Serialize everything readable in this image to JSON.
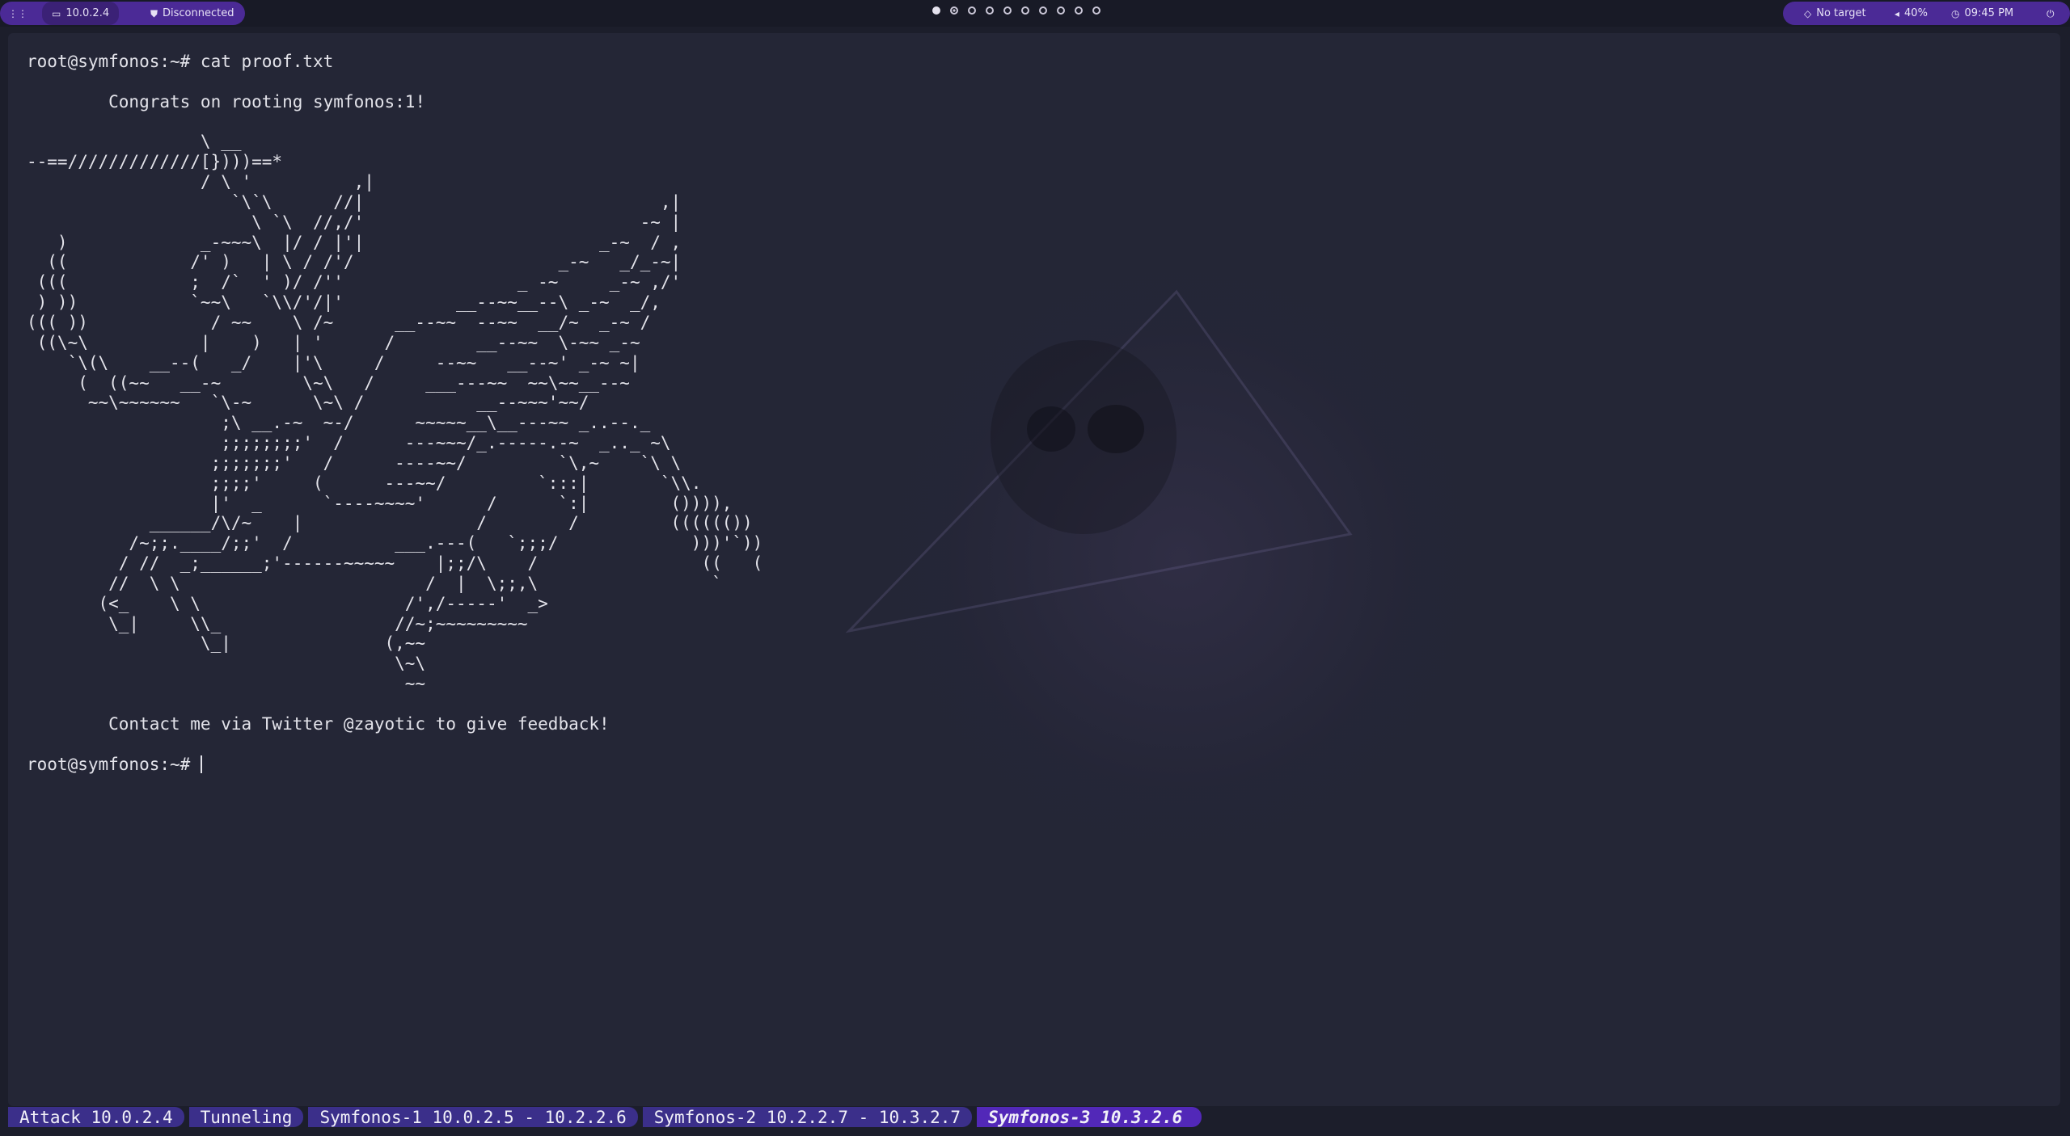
{
  "topbar": {
    "apps_icon": "grid-icon",
    "ip": "10.0.2.4",
    "vpn_status": "Disconnected",
    "workspaces": {
      "count": 10,
      "active_index": 1,
      "occupied_indices": [
        0
      ]
    },
    "target": "No target",
    "volume": "40%",
    "clock": "09:45 PM",
    "power_icon": "power-icon"
  },
  "terminal": {
    "lines": [
      "root@symfonos:~# cat proof.txt",
      "",
      "        Congrats on rooting symfonos:1!",
      "",
      "                 \\ __",
      "--==/////////////[})))==*",
      "                 / \\ '          ,|",
      "                    `\\`\\      //|                             ,|",
      "                      \\ `\\  //,/'                           -~ |",
      "   )             _-~~~\\  |/ / |'|                       _-~  / ,",
      "  ((            /' )   | \\ / /'/                    _-~   _/_-~|",
      " (((            ;  /`  ' )/ /''                 _ -~     _-~ ,/'",
      " ) ))           `~~\\   `\\\\/'/|'           __--~~__--\\ _-~  _/,",
      "((( ))            / ~~    \\ /~      __--~~  --~~  __/~  _-~ /",
      " ((\\~\\           |    )   | '      /        __--~~  \\-~~ _-~",
      "    `\\(\\    __--(   _/    |'\\     /     --~~   __--~' _-~ ~|",
      "     (  ((~~   __-~        \\~\\   /     ___---~~  ~~\\~~__--~",
      "      ~~\\~~~~~~   `\\-~      \\~\\ /           __--~~~'~~/",
      "                   ;\\ __.-~  ~-/      ~~~~~__\\__---~~ _..--._",
      "                   ;;;;;;;;'  /      ---~~~/_.-----.-~  _.._ ~\\",
      "                  ;;;;;;;'   /      ----~~/         `\\,~    `\\ \\",
      "                  ;;;;'     (      ---~~/         `:::|       `\\\\.",
      "                  |'  _      `----~~~~'      /      `:|        ()))),",
      "            ______/\\/~    |                 /        /         (((((())",
      "          /~;;.____/;;'  /          ___.---(   `;;;/             )))'`))",
      "         / //  _;______;'------~~~~~    |;;/\\    /                ((   (",
      "        //  \\ \\                        /  |  \\;;,\\                 `",
      "       (<_    \\ \\                    /',/-----'  _>",
      "        \\_|     \\\\_                 //~;~~~~~~~~~",
      "                 \\_|               (,~~",
      "                                    \\~\\",
      "                                     ~~",
      "",
      "        Contact me via Twitter @zayotic to give feedback!",
      "",
      ""
    ],
    "prompt": "root@symfonos:~# "
  },
  "statusbar": {
    "windows": [
      {
        "label": "Attack 10.0.2.4",
        "active": false
      },
      {
        "label": "Tunneling",
        "active": false
      },
      {
        "label": "Symfonos-1 10.0.2.5 - 10.2.2.6",
        "active": false
      },
      {
        "label": "Symfonos-2 10.2.2.7 - 10.3.2.7",
        "active": false
      },
      {
        "label": "Symfonos-3 10.3.2.6",
        "active": true
      }
    ]
  },
  "colors": {
    "bar_bg": "#181a26",
    "pill_bg": "#4b2a96",
    "terminal_bg": "#242636",
    "text": "#e3e3ea",
    "tmux_window": "#3b2f8a",
    "tmux_active": "#5228b8"
  }
}
